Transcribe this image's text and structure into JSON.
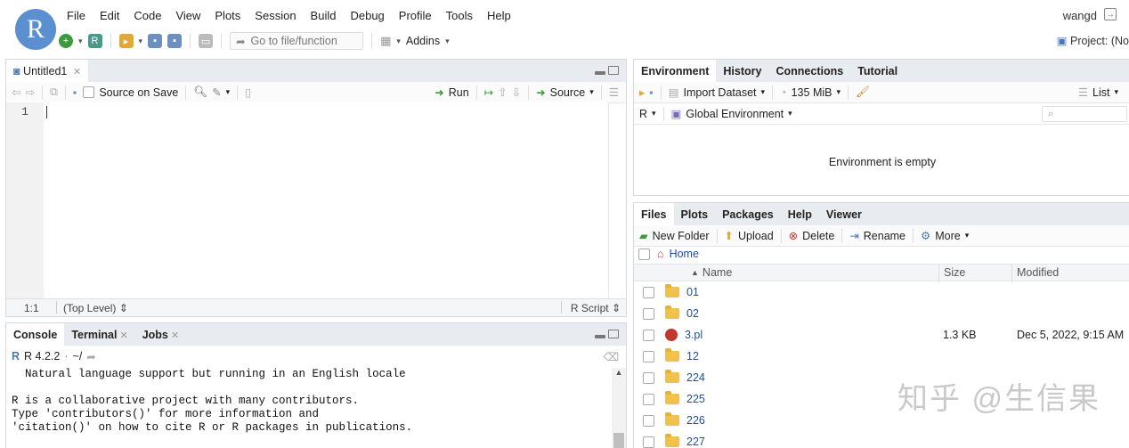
{
  "app": {
    "logo": "R",
    "user": "wangd",
    "project": "Project: (No"
  },
  "menu": [
    "File",
    "Edit",
    "Code",
    "View",
    "Plots",
    "Session",
    "Build",
    "Debug",
    "Profile",
    "Tools",
    "Help"
  ],
  "toolbar": {
    "goto_placeholder": "Go to file/function",
    "addins": "Addins"
  },
  "editor": {
    "tab": "Untitled1",
    "source_on_save": "Source on Save",
    "run": "Run",
    "source": "Source",
    "line_number": "1",
    "cursor_pos": "1:1",
    "scope": "(Top Level)",
    "file_type": "R Script"
  },
  "console": {
    "tabs": [
      "Console",
      "Terminal",
      "Jobs"
    ],
    "r_version": "R 4.2.2",
    "path": "~/",
    "lines": [
      "  Natural language support but running in an English locale",
      "",
      "R is a collaborative project with many contributors.",
      "Type 'contributors()' for more information and",
      "'citation()' on how to cite R or R packages in publications."
    ]
  },
  "environment": {
    "tabs": [
      "Environment",
      "History",
      "Connections",
      "Tutorial"
    ],
    "import_dataset": "Import Dataset",
    "memory": "135 MiB",
    "list": "List",
    "language": "R",
    "scope": "Global Environment",
    "empty_message": "Environment is empty"
  },
  "files": {
    "tabs": [
      "Files",
      "Plots",
      "Packages",
      "Help",
      "Viewer"
    ],
    "new_folder": "New Folder",
    "upload": "Upload",
    "delete": "Delete",
    "rename": "Rename",
    "more": "More",
    "breadcrumb": "Home",
    "columns": {
      "name": "Name",
      "size": "Size",
      "modified": "Modified"
    },
    "rows": [
      {
        "name": "01",
        "type": "folder",
        "size": "",
        "modified": ""
      },
      {
        "name": "02",
        "type": "folder",
        "size": "",
        "modified": ""
      },
      {
        "name": "3.pl",
        "type": "file",
        "size": "1.3 KB",
        "modified": "Dec 5, 2022, 9:15 AM"
      },
      {
        "name": "12",
        "type": "folder",
        "size": "",
        "modified": ""
      },
      {
        "name": "224",
        "type": "folder",
        "size": "",
        "modified": ""
      },
      {
        "name": "225",
        "type": "folder",
        "size": "",
        "modified": ""
      },
      {
        "name": "226",
        "type": "folder",
        "size": "",
        "modified": ""
      },
      {
        "name": "227",
        "type": "folder",
        "size": "",
        "modified": ""
      }
    ]
  },
  "watermark": "知乎 @生信果",
  "colors": {
    "accent": "#1d4fa0",
    "folder": "#f0c14b",
    "tabbar": "#e8ebef"
  }
}
